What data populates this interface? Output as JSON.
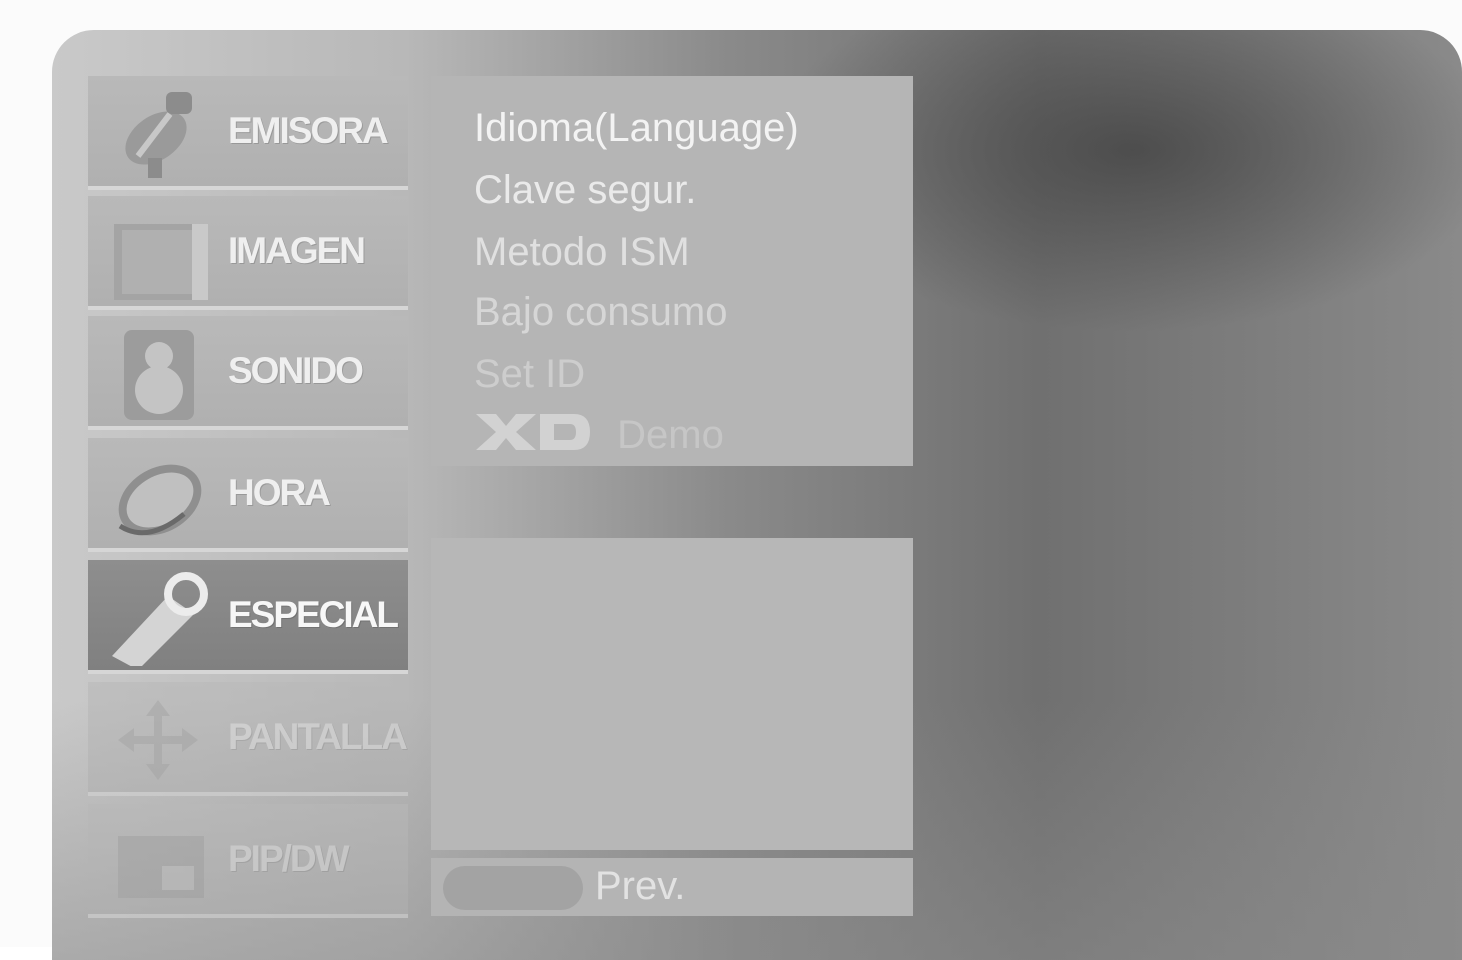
{
  "sidebar": {
    "items": [
      {
        "label": "EMISORA",
        "icon": "satellite-dish-icon",
        "state": "normal"
      },
      {
        "label": "IMAGEN",
        "icon": "picture-icon",
        "state": "normal"
      },
      {
        "label": "SONIDO",
        "icon": "speaker-icon",
        "state": "normal"
      },
      {
        "label": "HORA",
        "icon": "clock-icon",
        "state": "normal"
      },
      {
        "label": "ESPECIAL",
        "icon": "tag-icon",
        "state": "selected"
      },
      {
        "label": "PANTALLA",
        "icon": "move-arrows-icon",
        "state": "dimmed"
      },
      {
        "label": "PIP/DW",
        "icon": "pip-screen-icon",
        "state": "dimmed"
      }
    ]
  },
  "options": {
    "items": [
      {
        "label": "Idioma(Language)"
      },
      {
        "label": "Clave segur."
      },
      {
        "label": "Metodo ISM"
      },
      {
        "label": "Bajo consumo"
      },
      {
        "label": "Set ID"
      },
      {
        "label": "Demo",
        "prefix_logo": "XD"
      }
    ]
  },
  "footer": {
    "button_color": "blue",
    "label": "Prev."
  }
}
